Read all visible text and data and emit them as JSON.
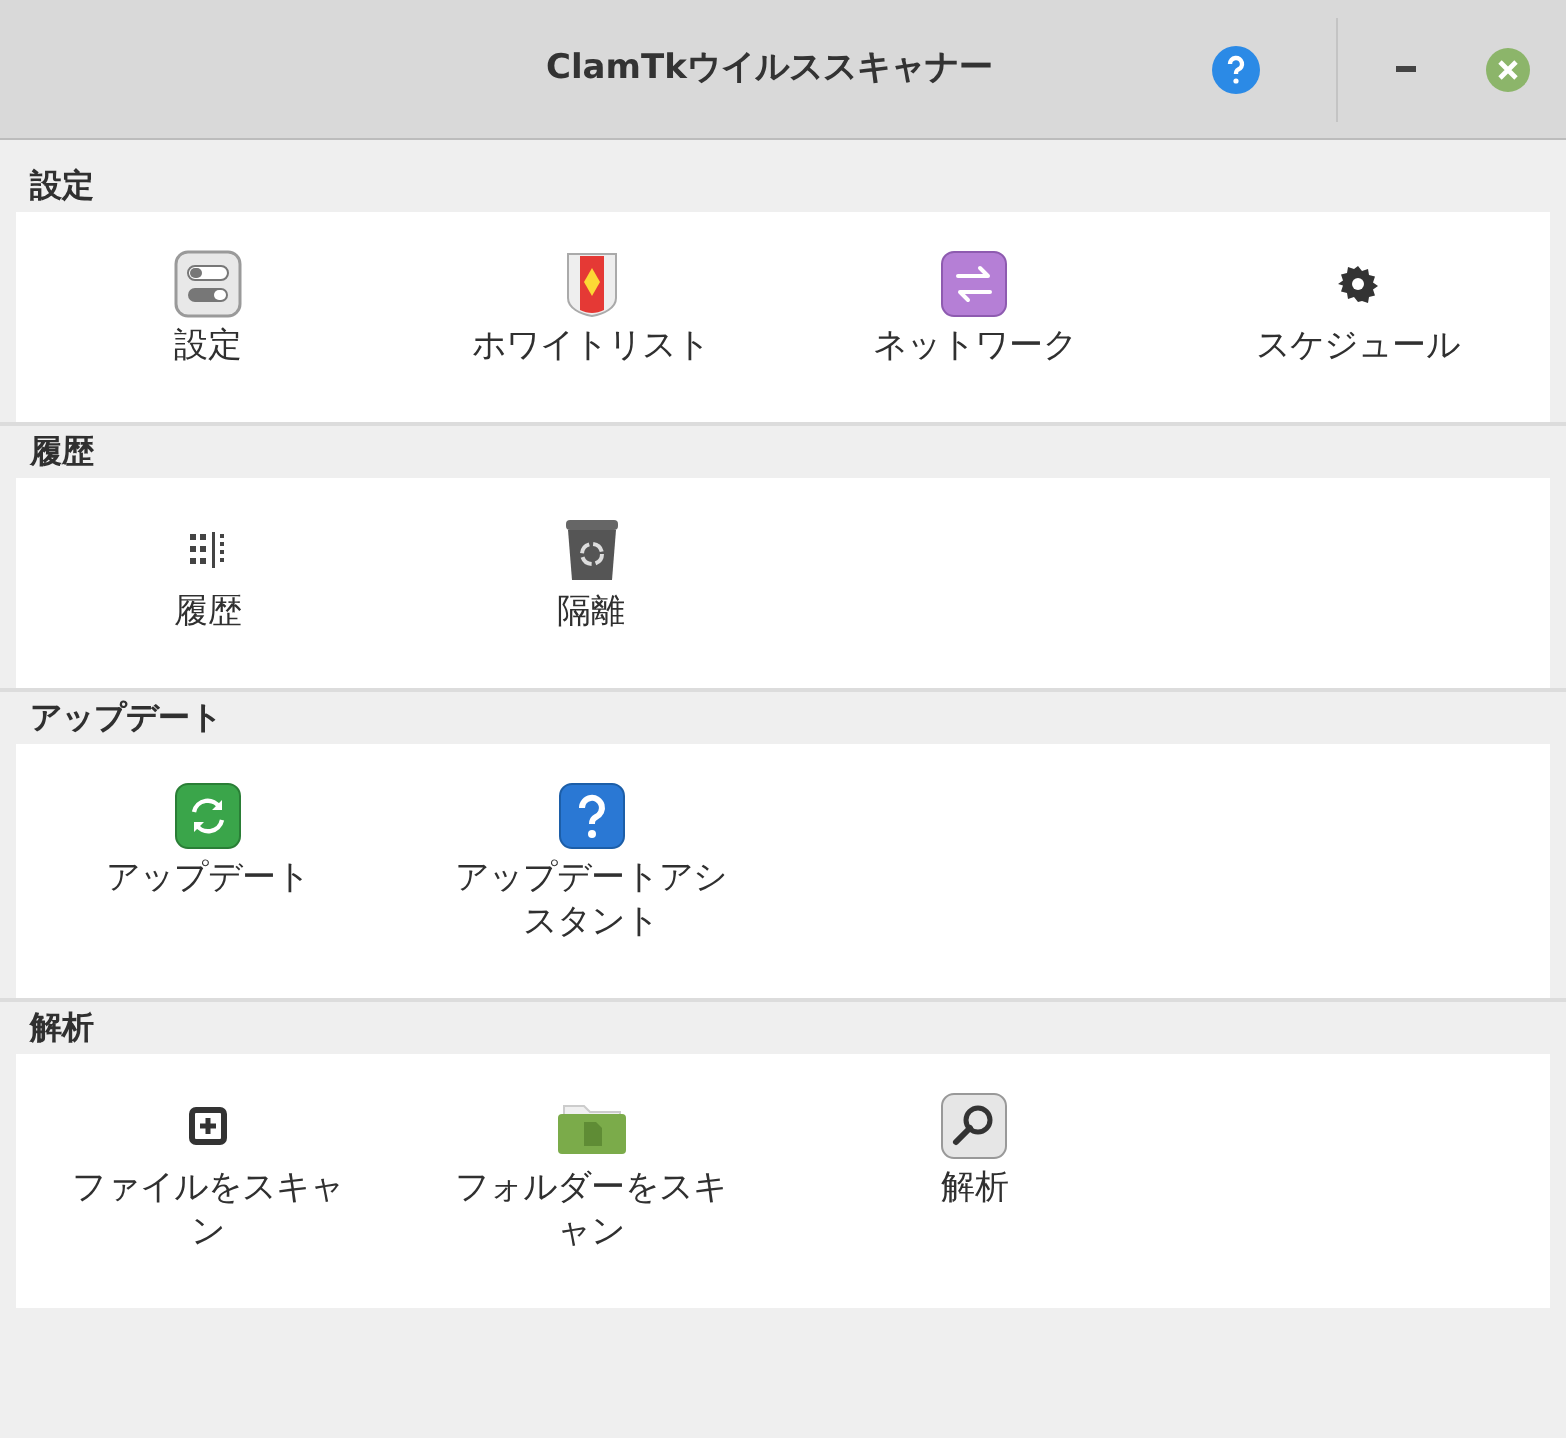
{
  "window": {
    "title": "ClamTkウイルススキャナー"
  },
  "sections": [
    {
      "heading": "設定",
      "items": [
        {
          "label": "設定",
          "kind": "toggles"
        },
        {
          "label": "ホワイトリスト",
          "kind": "shield"
        },
        {
          "label": "ネットワーク",
          "kind": "network"
        },
        {
          "label": "スケジュール",
          "kind": "gear"
        }
      ]
    },
    {
      "heading": "履歴",
      "items": [
        {
          "label": "履歴",
          "kind": "dots"
        },
        {
          "label": "隔離",
          "kind": "trash"
        }
      ]
    },
    {
      "heading": "アップデート",
      "items": [
        {
          "label": "アップデート",
          "kind": "refresh"
        },
        {
          "label": "アップデートアシスタント",
          "kind": "question"
        }
      ]
    },
    {
      "heading": "解析",
      "items": [
        {
          "label": "ファイルをスキャン",
          "kind": "file"
        },
        {
          "label": "フォルダーをスキャン",
          "kind": "folder"
        },
        {
          "label": "解析",
          "kind": "search"
        }
      ]
    }
  ]
}
